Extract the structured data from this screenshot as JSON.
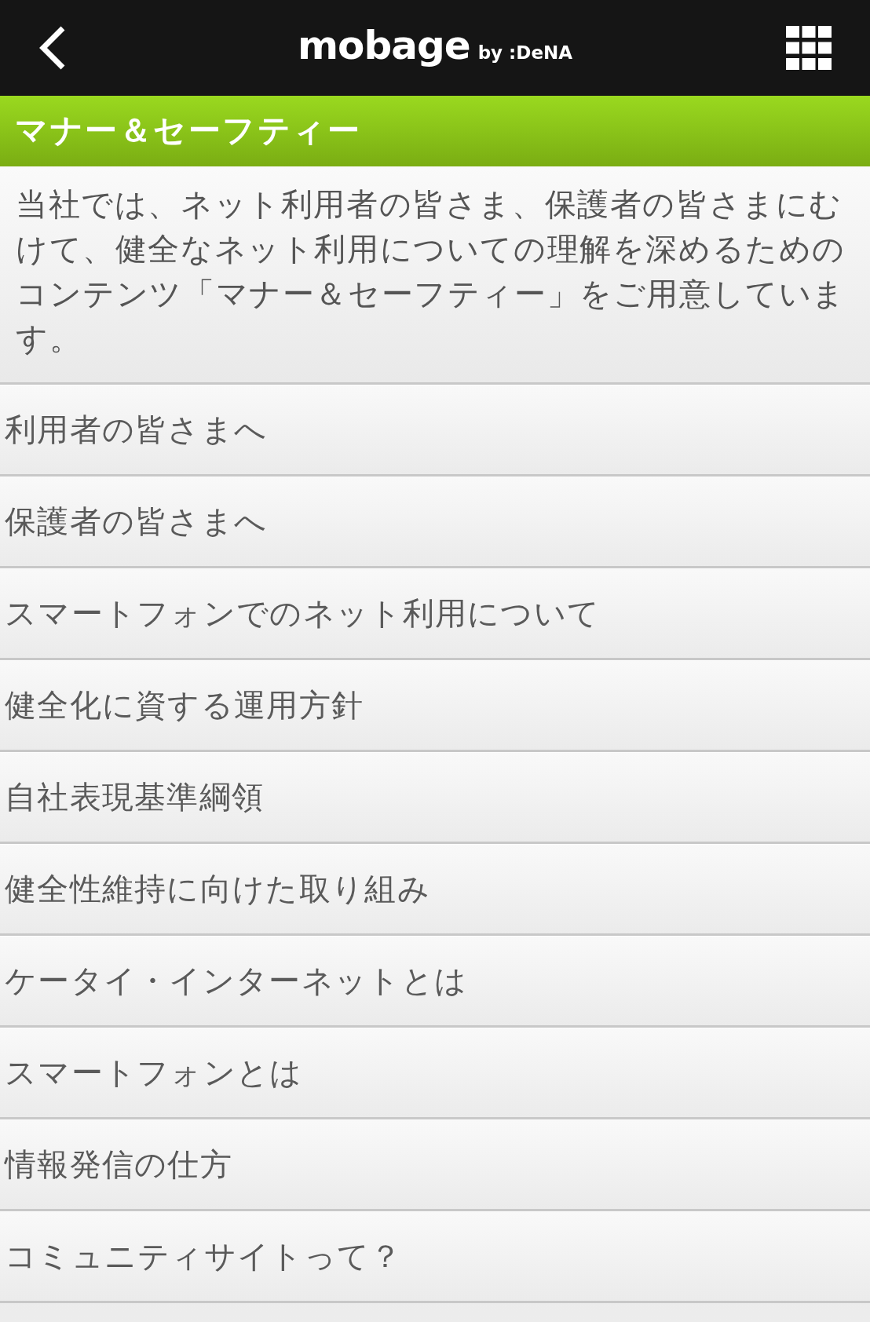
{
  "header": {
    "logo": {
      "wordmark": "mobage",
      "byline": "by :DeNA"
    }
  },
  "section_title": "マナー＆セーフティー",
  "intro": "当社では、ネット利用者の皆さま、保護者の皆さまにむけて、健全なネット利用についての理解を深めるためのコンテンツ「マナー＆セーフティー」をご用意しています。",
  "menu_items": [
    "利用者の皆さまへ",
    "保護者の皆さまへ",
    "スマートフォンでのネット利用について",
    "健全化に資する運用方針",
    "自社表現基準綱領",
    "健全性維持に向けた取り組み",
    "ケータイ・インターネットとは",
    "スマートフォンとは",
    "情報発信の仕方",
    "コミュニティサイトって？"
  ]
}
